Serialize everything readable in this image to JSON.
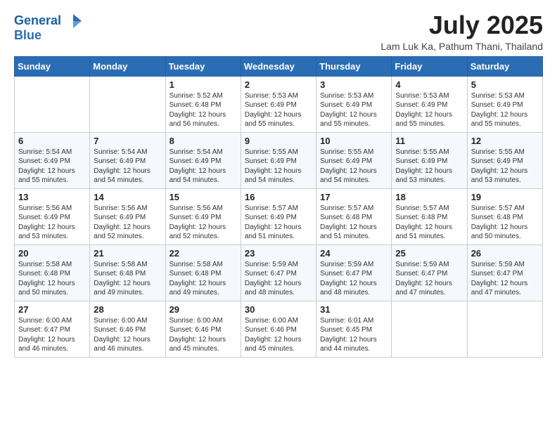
{
  "logo": {
    "text1": "General",
    "text2": "Blue"
  },
  "title": "July 2025",
  "subtitle": "Lam Luk Ka, Pathum Thani, Thailand",
  "days_of_week": [
    "Sunday",
    "Monday",
    "Tuesday",
    "Wednesday",
    "Thursday",
    "Friday",
    "Saturday"
  ],
  "weeks": [
    [
      {
        "day": "",
        "sunrise": "",
        "sunset": "",
        "daylight": ""
      },
      {
        "day": "",
        "sunrise": "",
        "sunset": "",
        "daylight": ""
      },
      {
        "day": "1",
        "sunrise": "Sunrise: 5:52 AM",
        "sunset": "Sunset: 6:48 PM",
        "daylight": "Daylight: 12 hours and 56 minutes."
      },
      {
        "day": "2",
        "sunrise": "Sunrise: 5:53 AM",
        "sunset": "Sunset: 6:49 PM",
        "daylight": "Daylight: 12 hours and 55 minutes."
      },
      {
        "day": "3",
        "sunrise": "Sunrise: 5:53 AM",
        "sunset": "Sunset: 6:49 PM",
        "daylight": "Daylight: 12 hours and 55 minutes."
      },
      {
        "day": "4",
        "sunrise": "Sunrise: 5:53 AM",
        "sunset": "Sunset: 6:49 PM",
        "daylight": "Daylight: 12 hours and 55 minutes."
      },
      {
        "day": "5",
        "sunrise": "Sunrise: 5:53 AM",
        "sunset": "Sunset: 6:49 PM",
        "daylight": "Daylight: 12 hours and 55 minutes."
      }
    ],
    [
      {
        "day": "6",
        "sunrise": "Sunrise: 5:54 AM",
        "sunset": "Sunset: 6:49 PM",
        "daylight": "Daylight: 12 hours and 55 minutes."
      },
      {
        "day": "7",
        "sunrise": "Sunrise: 5:54 AM",
        "sunset": "Sunset: 6:49 PM",
        "daylight": "Daylight: 12 hours and 54 minutes."
      },
      {
        "day": "8",
        "sunrise": "Sunrise: 5:54 AM",
        "sunset": "Sunset: 6:49 PM",
        "daylight": "Daylight: 12 hours and 54 minutes."
      },
      {
        "day": "9",
        "sunrise": "Sunrise: 5:55 AM",
        "sunset": "Sunset: 6:49 PM",
        "daylight": "Daylight: 12 hours and 54 minutes."
      },
      {
        "day": "10",
        "sunrise": "Sunrise: 5:55 AM",
        "sunset": "Sunset: 6:49 PM",
        "daylight": "Daylight: 12 hours and 54 minutes."
      },
      {
        "day": "11",
        "sunrise": "Sunrise: 5:55 AM",
        "sunset": "Sunset: 6:49 PM",
        "daylight": "Daylight: 12 hours and 53 minutes."
      },
      {
        "day": "12",
        "sunrise": "Sunrise: 5:55 AM",
        "sunset": "Sunset: 6:49 PM",
        "daylight": "Daylight: 12 hours and 53 minutes."
      }
    ],
    [
      {
        "day": "13",
        "sunrise": "Sunrise: 5:56 AM",
        "sunset": "Sunset: 6:49 PM",
        "daylight": "Daylight: 12 hours and 53 minutes."
      },
      {
        "day": "14",
        "sunrise": "Sunrise: 5:56 AM",
        "sunset": "Sunset: 6:49 PM",
        "daylight": "Daylight: 12 hours and 52 minutes."
      },
      {
        "day": "15",
        "sunrise": "Sunrise: 5:56 AM",
        "sunset": "Sunset: 6:49 PM",
        "daylight": "Daylight: 12 hours and 52 minutes."
      },
      {
        "day": "16",
        "sunrise": "Sunrise: 5:57 AM",
        "sunset": "Sunset: 6:49 PM",
        "daylight": "Daylight: 12 hours and 51 minutes."
      },
      {
        "day": "17",
        "sunrise": "Sunrise: 5:57 AM",
        "sunset": "Sunset: 6:48 PM",
        "daylight": "Daylight: 12 hours and 51 minutes."
      },
      {
        "day": "18",
        "sunrise": "Sunrise: 5:57 AM",
        "sunset": "Sunset: 6:48 PM",
        "daylight": "Daylight: 12 hours and 51 minutes."
      },
      {
        "day": "19",
        "sunrise": "Sunrise: 5:57 AM",
        "sunset": "Sunset: 6:48 PM",
        "daylight": "Daylight: 12 hours and 50 minutes."
      }
    ],
    [
      {
        "day": "20",
        "sunrise": "Sunrise: 5:58 AM",
        "sunset": "Sunset: 6:48 PM",
        "daylight": "Daylight: 12 hours and 50 minutes."
      },
      {
        "day": "21",
        "sunrise": "Sunrise: 5:58 AM",
        "sunset": "Sunset: 6:48 PM",
        "daylight": "Daylight: 12 hours and 49 minutes."
      },
      {
        "day": "22",
        "sunrise": "Sunrise: 5:58 AM",
        "sunset": "Sunset: 6:48 PM",
        "daylight": "Daylight: 12 hours and 49 minutes."
      },
      {
        "day": "23",
        "sunrise": "Sunrise: 5:59 AM",
        "sunset": "Sunset: 6:47 PM",
        "daylight": "Daylight: 12 hours and 48 minutes."
      },
      {
        "day": "24",
        "sunrise": "Sunrise: 5:59 AM",
        "sunset": "Sunset: 6:47 PM",
        "daylight": "Daylight: 12 hours and 48 minutes."
      },
      {
        "day": "25",
        "sunrise": "Sunrise: 5:59 AM",
        "sunset": "Sunset: 6:47 PM",
        "daylight": "Daylight: 12 hours and 47 minutes."
      },
      {
        "day": "26",
        "sunrise": "Sunrise: 5:59 AM",
        "sunset": "Sunset: 6:47 PM",
        "daylight": "Daylight: 12 hours and 47 minutes."
      }
    ],
    [
      {
        "day": "27",
        "sunrise": "Sunrise: 6:00 AM",
        "sunset": "Sunset: 6:47 PM",
        "daylight": "Daylight: 12 hours and 46 minutes."
      },
      {
        "day": "28",
        "sunrise": "Sunrise: 6:00 AM",
        "sunset": "Sunset: 6:46 PM",
        "daylight": "Daylight: 12 hours and 46 minutes."
      },
      {
        "day": "29",
        "sunrise": "Sunrise: 6:00 AM",
        "sunset": "Sunset: 6:46 PM",
        "daylight": "Daylight: 12 hours and 45 minutes."
      },
      {
        "day": "30",
        "sunrise": "Sunrise: 6:00 AM",
        "sunset": "Sunset: 6:46 PM",
        "daylight": "Daylight: 12 hours and 45 minutes."
      },
      {
        "day": "31",
        "sunrise": "Sunrise: 6:01 AM",
        "sunset": "Sunset: 6:45 PM",
        "daylight": "Daylight: 12 hours and 44 minutes."
      },
      {
        "day": "",
        "sunrise": "",
        "sunset": "",
        "daylight": ""
      },
      {
        "day": "",
        "sunrise": "",
        "sunset": "",
        "daylight": ""
      }
    ]
  ]
}
